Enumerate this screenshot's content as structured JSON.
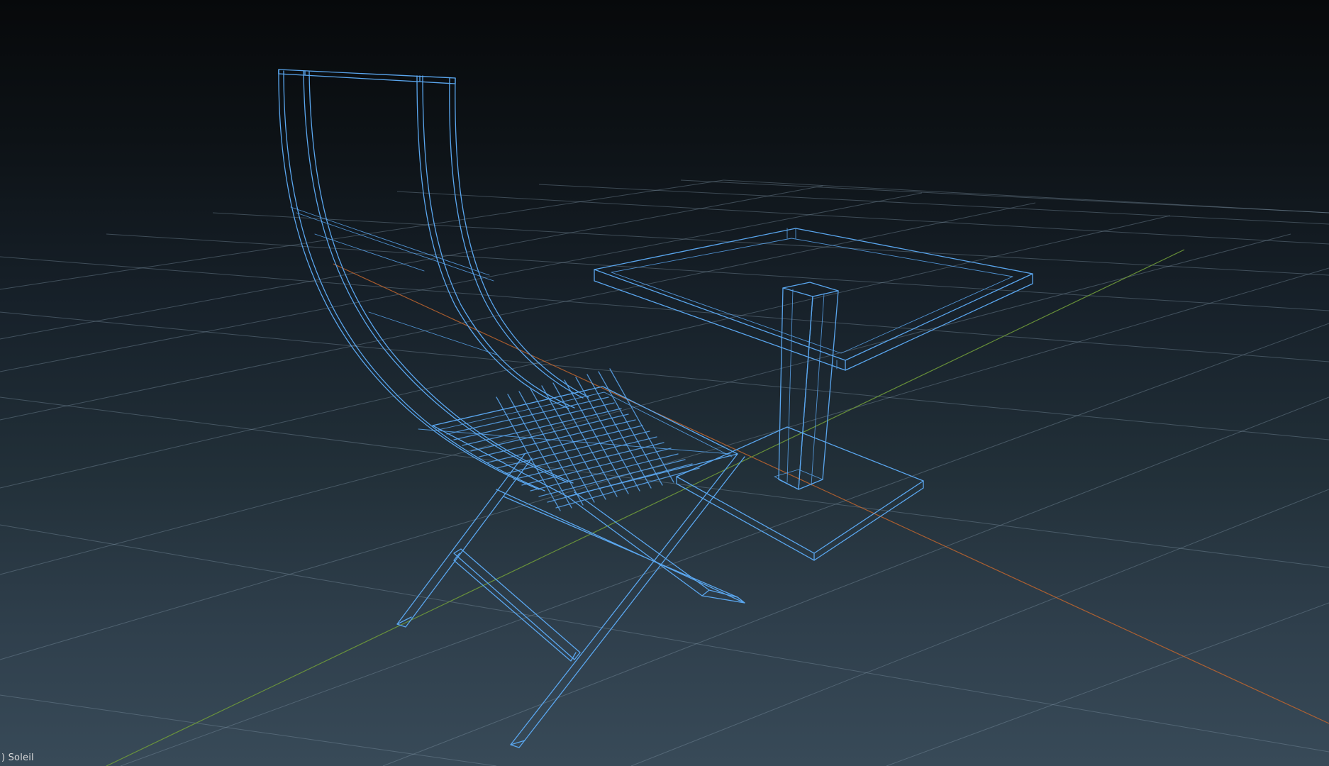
{
  "viewport": {
    "view_mode": "wireframe",
    "grid": true,
    "axes": {
      "x_axis_color": "#c0652e",
      "y_axis_color": "#6f9a3a"
    },
    "wire_color": "#5aa6ee",
    "objects": [
      "chair",
      "side-table"
    ]
  },
  "status": {
    "label": ") Soleil"
  }
}
